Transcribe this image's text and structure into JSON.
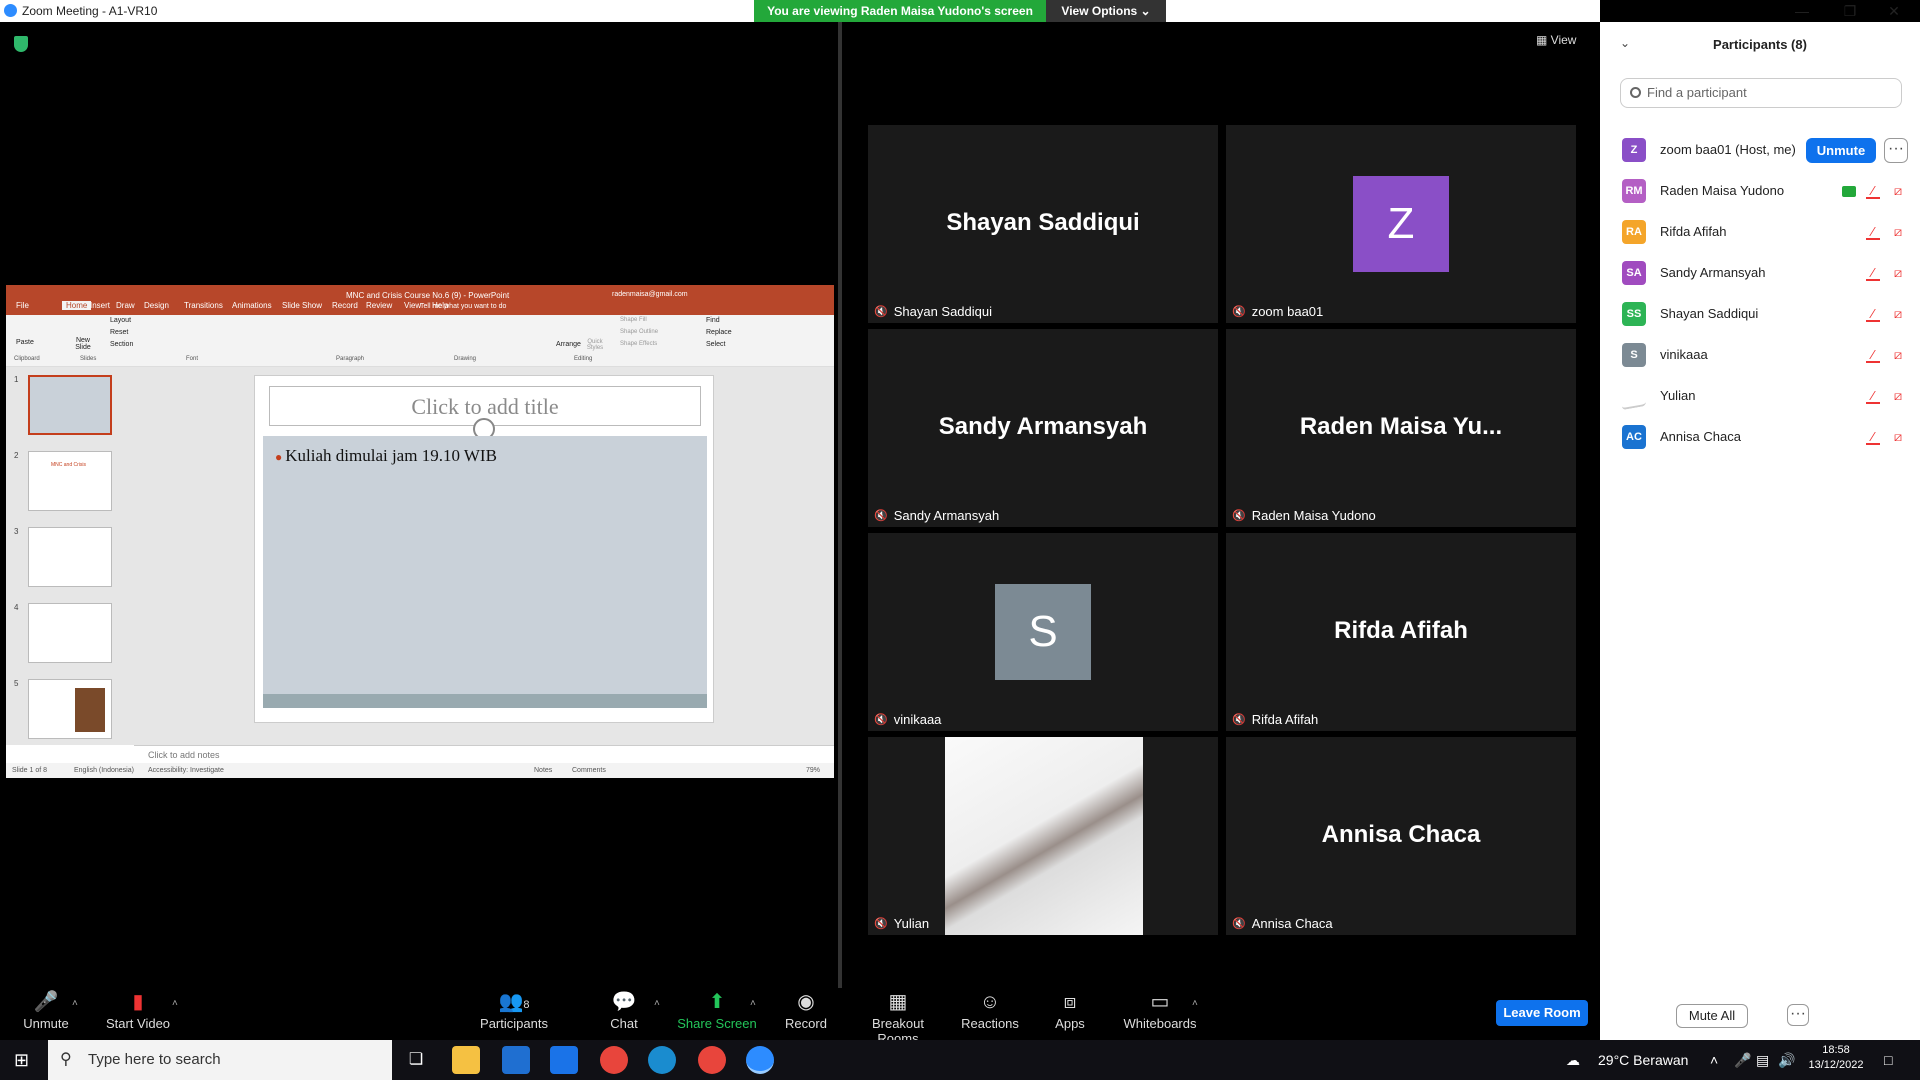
{
  "window": {
    "title": "Zoom Meeting - A1-VR10",
    "banner": "You are viewing Raden Maisa Yudono's screen",
    "view_options": "View Options ⌄"
  },
  "view_button": "View",
  "ppt": {
    "window_title": "MNC and Crisis Course No.6 (9)  -  PowerPoint",
    "user_email": "radenmaisa@gmail.com",
    "tabs": [
      "File",
      "Home",
      "Insert",
      "Draw",
      "Design",
      "Transitions",
      "Animations",
      "Slide Show",
      "Record",
      "Review",
      "View",
      "Help"
    ],
    "tell_me": "Tell me what you want to do",
    "groups": [
      "Clipboard",
      "Slides",
      "Font",
      "Paragraph",
      "Drawing",
      "Editing"
    ],
    "ribbon": {
      "paste": "Paste",
      "new_slide": "New Slide",
      "layout": "Layout",
      "reset": "Reset",
      "section": "Section",
      "arrange": "Arrange",
      "quick_styles": "Quick Styles",
      "shape_fill": "Shape Fill",
      "shape_outline": "Shape Outline",
      "shape_effects": "Shape Effects",
      "find": "Find",
      "replace": "Replace",
      "select": "Select"
    },
    "slide_title_placeholder": "Click to add title",
    "bullet": "Kuliah dimulai jam 19.10 WIB",
    "notes_placeholder": "Click to add notes",
    "thumb_numbers": [
      "1",
      "2",
      "3",
      "4",
      "5"
    ],
    "thumb2_title": "MNC and Crisis",
    "status": {
      "slide": "Slide 1 of 8",
      "language": "English (Indonesia)",
      "accessibility": "Accessibility: Investigate",
      "notes": "Notes",
      "comments": "Comments",
      "zoom": "79%"
    }
  },
  "gallery": [
    {
      "big_name": "Shayan Saddiqui",
      "label": "Shayan Saddiqui"
    },
    {
      "avatar": "Z",
      "label": "zoom baa01"
    },
    {
      "big_name": "Sandy Armansyah",
      "label": "Sandy Armansyah"
    },
    {
      "big_name": "Raden  Maisa  Yu...",
      "label": "Raden Maisa Yudono"
    },
    {
      "avatar": "S",
      "label": "vinikaaa"
    },
    {
      "big_name": "Rifda Afifah",
      "label": "Rifda Afifah"
    },
    {
      "label": "Yulian"
    },
    {
      "big_name": "Annisa Chaca",
      "label": "Annisa Chaca"
    }
  ],
  "participants": {
    "header": "Participants (8)",
    "search_placeholder": "Find a participant",
    "unmute": "Unmute",
    "more": "···",
    "rows": [
      {
        "initials": "Z",
        "name": "zoom baa01 (Host, me)",
        "color": "#8a4fc7"
      },
      {
        "initials": "RM",
        "name": "Raden Maisa Yudono",
        "color": "#b45fc4"
      },
      {
        "initials": "RA",
        "name": "Rifda Afifah",
        "color": "#f4a52a"
      },
      {
        "initials": "SA",
        "name": "Sandy Armansyah",
        "color": "#a04bbf"
      },
      {
        "initials": "SS",
        "name": "Shayan Saddiqui",
        "color": "#2db455"
      },
      {
        "initials": "S",
        "name": "vinikaaa",
        "color": "#7c8a94"
      },
      {
        "initials": "",
        "name": "Yulian",
        "color": "#dddddd"
      },
      {
        "initials": "AC",
        "name": "Annisa Chaca",
        "color": "#1a73d1"
      }
    ],
    "mute_all": "Mute All"
  },
  "toolbar": {
    "unmute": "Unmute",
    "start_video": "Start Video",
    "participants": "Participants",
    "participants_count": "8",
    "chat": "Chat",
    "share_screen": "Share Screen",
    "record": "Record",
    "breakout": "Breakout Rooms",
    "reactions": "Reactions",
    "apps": "Apps",
    "whiteboards": "Whiteboards",
    "leave": "Leave Room"
  },
  "taskbar": {
    "search_placeholder": "Type here to search",
    "weather": "29°C  Berawan",
    "time": "18:58",
    "date": "13/12/2022"
  },
  "colors": {
    "zoom_blue": "#0e72ed",
    "banner_green": "#23a83a",
    "ppt_red": "#b7472a",
    "mute_red": "#e33333"
  }
}
